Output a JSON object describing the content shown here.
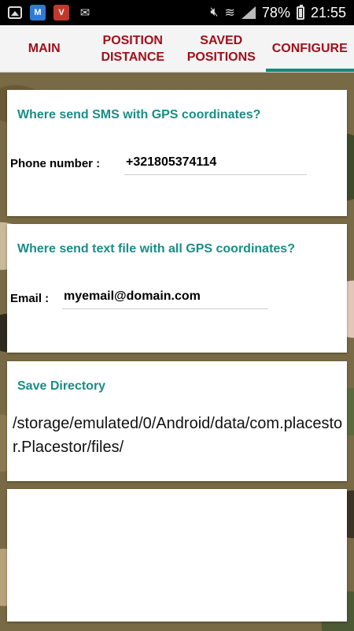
{
  "status_bar": {
    "battery": "78%",
    "time": "21:55",
    "icons": [
      "gallery-icon",
      "maps-icon",
      "shield-icon",
      "mail-x-icon",
      "mute-icon",
      "wifi-icon",
      "signal-icon",
      "battery-icon"
    ]
  },
  "tabs": [
    {
      "label": "MAIN",
      "active": false
    },
    {
      "label": "POSITION\nDISTANCE",
      "active": false
    },
    {
      "label": "SAVED\nPOSITIONS",
      "active": false
    },
    {
      "label": "CONFIGURE",
      "active": true
    }
  ],
  "colors": {
    "tab_text": "#a0101a",
    "accent": "#0e8a7e",
    "card_title": "#1b8c86"
  },
  "sms_card": {
    "title": "Where send SMS with GPS coordinates?",
    "phone_label": "Phone number :",
    "phone_value": "+321805374114"
  },
  "email_card": {
    "title": "Where send text file with all GPS  coordinates?",
    "email_label": "Email :",
    "email_value": "myemail@domain.com"
  },
  "directory_card": {
    "title": "Save Directory",
    "path": "/storage/emulated/0/Android/data/com.placestor.Placestor/files/"
  }
}
